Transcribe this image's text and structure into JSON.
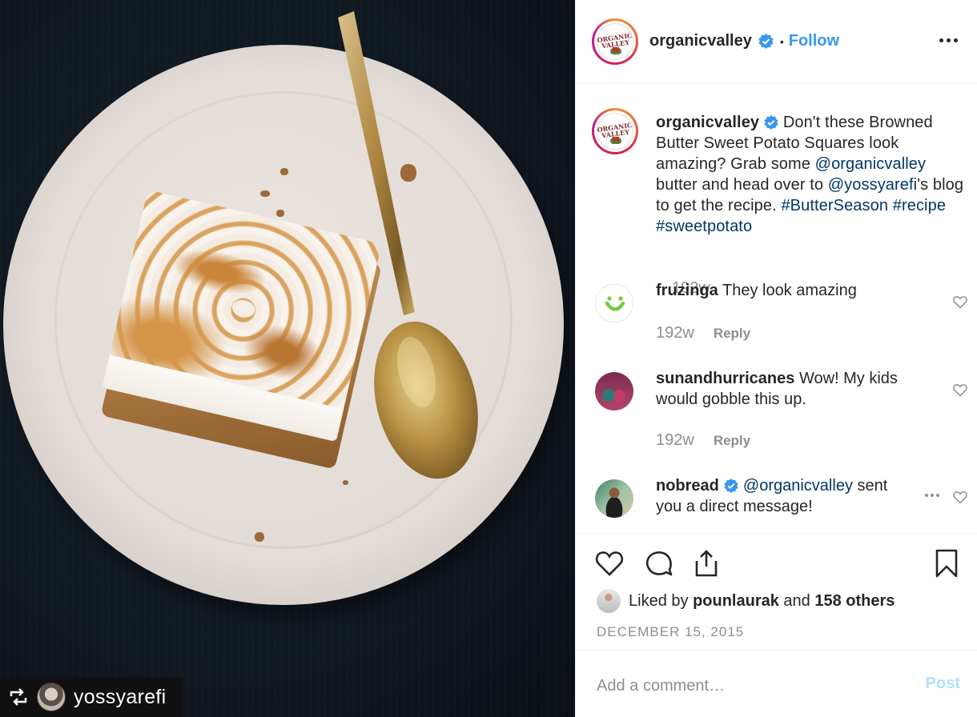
{
  "photo": {
    "regram_user": "yossyarefi"
  },
  "header": {
    "username": "organicvalley",
    "separator": "•",
    "follow_label": "Follow",
    "logo_text": "ORGANIC VALLEY"
  },
  "caption": {
    "username": "organicvalley",
    "text_before": " Don't these Browned Butter Sweet Potato Squares look amazing? Grab some ",
    "mention1": "@organicvalley",
    "text_mid": " butter and head over to ",
    "mention2": "@yossyarefi",
    "text_after": "'s blog to get the recipe. ",
    "tag1": "#ButterSeason",
    "tag2": "#recipe",
    "tag3": "#sweetpotato",
    "time": "192w"
  },
  "comments": [
    {
      "username": "fruzinga",
      "text": " They look amazing",
      "time": "192w",
      "reply": "Reply"
    },
    {
      "username": "sunandhurricanes",
      "text": " Wow! My kids would gobble this up.",
      "time": "192w",
      "reply": "Reply"
    },
    {
      "username": "nobread",
      "mention": "@organicvalley",
      "text": " sent you a direct message!"
    }
  ],
  "likes": {
    "prefix": "Liked by ",
    "user": "pounlaurak",
    "mid": " and ",
    "others": "158 others"
  },
  "date": "DECEMBER 15, 2015",
  "comment_box": {
    "placeholder": "Add a comment…",
    "post_label": "Post"
  },
  "colors": {
    "link": "#003569",
    "follow": "#3897f0",
    "muted": "#8e8e8e",
    "post_disabled": "#b2dffc"
  }
}
